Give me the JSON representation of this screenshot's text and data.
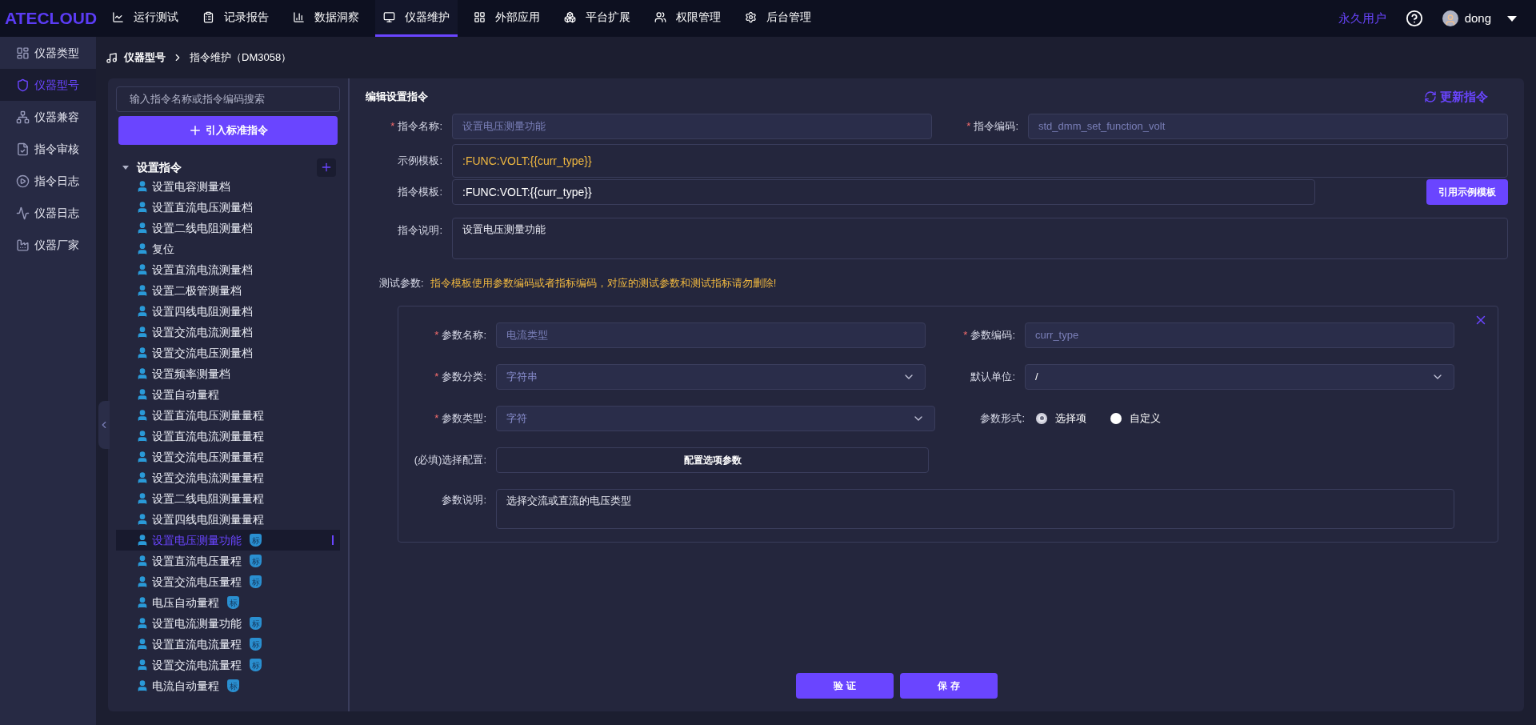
{
  "logo": "ATECLOUD",
  "nav": [
    {
      "label": "运行测试",
      "selected": false
    },
    {
      "label": "记录报告",
      "selected": false
    },
    {
      "label": "数据洞察",
      "selected": false
    },
    {
      "label": "仪器维护",
      "selected": true
    },
    {
      "label": "外部应用",
      "selected": false
    },
    {
      "label": "平台扩展",
      "selected": false
    },
    {
      "label": "权限管理",
      "selected": false
    },
    {
      "label": "后台管理",
      "selected": false
    }
  ],
  "user": {
    "plan": "永久用户",
    "name": "dong"
  },
  "sidebar": {
    "items": [
      {
        "label": "仪器类型",
        "selected": false
      },
      {
        "label": "仪器型号",
        "selected": true
      },
      {
        "label": "仪器兼容",
        "selected": false
      },
      {
        "label": "指令审核",
        "selected": false
      },
      {
        "label": "指令日志",
        "selected": false
      },
      {
        "label": "仪器日志",
        "selected": false
      },
      {
        "label": "仪器厂家",
        "selected": false
      }
    ]
  },
  "breadcrumb": [
    "仪器型号",
    "指令维护（DM3058）"
  ],
  "tree": {
    "search": {
      "placeholder": "输入指令名称或指令编码搜索"
    },
    "import_button": "引入标准指令",
    "group": {
      "label": "设置指令",
      "expanded": true,
      "children": [
        {
          "label": "设置电容测量档",
          "selected": false
        },
        {
          "label": "设置直流电压测量档",
          "selected": false
        },
        {
          "label": "设置二线电阻测量档",
          "selected": false
        },
        {
          "label": "复位",
          "selected": false
        },
        {
          "label": "设置直流电流测量档",
          "selected": false
        },
        {
          "label": "设置二极管测量档",
          "selected": false
        },
        {
          "label": "设置四线电阻测量档",
          "selected": false
        },
        {
          "label": "设置交流电流测量档",
          "selected": false
        },
        {
          "label": "设置交流电压测量档",
          "selected": false
        },
        {
          "label": "设置频率测量档",
          "selected": false
        },
        {
          "label": "设置自动量程",
          "selected": false
        },
        {
          "label": "设置直流电压测量量程",
          "selected": false
        },
        {
          "label": "设置直流电流测量量程",
          "selected": false
        },
        {
          "label": "设置交流电压测量量程",
          "selected": false
        },
        {
          "label": "设置交流电流测量量程",
          "selected": false
        },
        {
          "label": "设置二线电阻测量量程",
          "selected": false
        },
        {
          "label": "设置四线电阻测量量程",
          "selected": false
        },
        {
          "label": "设置电压测量功能",
          "badge": "标",
          "selected": true
        },
        {
          "label": "设置直流电压量程",
          "badge": "标",
          "selected": false
        },
        {
          "label": "设置交流电压量程",
          "badge": "标",
          "selected": false
        },
        {
          "label": "电压自动量程",
          "badge": "标",
          "selected": false
        },
        {
          "label": "设置电流测量功能",
          "badge": "标",
          "selected": false
        },
        {
          "label": "设置直流电流量程",
          "badge": "标",
          "selected": false
        },
        {
          "label": "设置交流电流量程",
          "badge": "标",
          "selected": false
        },
        {
          "label": "电流自动量程",
          "badge": "标",
          "selected": false
        }
      ]
    }
  },
  "form": {
    "title": "编辑设置指令",
    "refresh_button": "更新指令",
    "name": {
      "mark": "*",
      "label": "指令名称:",
      "disabled": true,
      "value": "设置电压测量功能"
    },
    "code": {
      "mark": "*",
      "label": "指令编码:",
      "disabled": true,
      "value": "std_dmm_set_function_volt"
    },
    "example_template": {
      "label": "示例模板:",
      "highlighted": true,
      "value": ":FUNC:VOLT:{{curr_type}}"
    },
    "template": {
      "label": "指令模板:",
      "highlighted": false,
      "value": ":FUNC:VOLT:{{curr_type}}"
    },
    "cite_button": "引用示例模板",
    "description": {
      "label": "指令说明:",
      "value": "设置电压测量功能"
    },
    "test_params": {
      "label": "测试参数:",
      "warning": "指令模板使用参数编码或者指标编码，对应的测试参数和测试指标请勿删除!"
    }
  },
  "param": {
    "name": {
      "mark": "*",
      "label": "参数名称:",
      "disabled": true,
      "value": "电流类型"
    },
    "code": {
      "mark": "*",
      "label": "参数编码:",
      "disabled": true,
      "value": "curr_type"
    },
    "category": {
      "mark": "*",
      "label": "参数分类:",
      "value": "字符串"
    },
    "unit": {
      "label": "默认单位:",
      "value": "/"
    },
    "type": {
      "mark": "*",
      "label": "参数类型:",
      "value": "字符"
    },
    "form": {
      "label": "参数形式:",
      "options": [
        {
          "label": "选择项",
          "selected": true
        },
        {
          "label": "自定义",
          "selected": false
        }
      ]
    },
    "config": {
      "label": "(必填)选择配置:",
      "button": "配置选项参数"
    },
    "description": {
      "label": "参数说明:",
      "value": "选择交流或直流的电压类型"
    }
  },
  "actions": [
    "验 证",
    "保 存"
  ]
}
